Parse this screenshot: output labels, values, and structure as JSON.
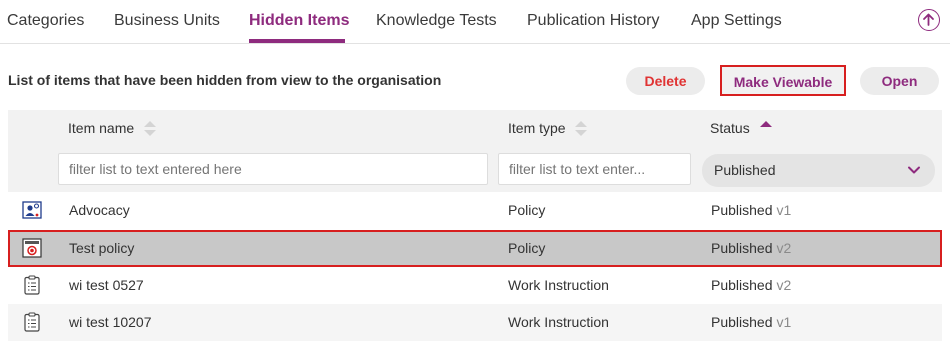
{
  "tabs": [
    {
      "label": "Categories"
    },
    {
      "label": "Business Units"
    },
    {
      "label": "Hidden Items"
    },
    {
      "label": "Knowledge Tests"
    },
    {
      "label": "Publication History"
    },
    {
      "label": "App Settings"
    }
  ],
  "active_tab": "Hidden Items",
  "toolbar": {
    "description": "List of items that have been hidden from view to the organisation",
    "delete_label": "Delete",
    "make_viewable_label": "Make Viewable",
    "open_label": "Open"
  },
  "table": {
    "columns": {
      "item_name": "Item name",
      "item_type": "Item type",
      "status": "Status"
    },
    "filters": {
      "name_placeholder": "filter list to text entered here",
      "type_placeholder": "filter list to text enter...",
      "status_selected": "Published"
    },
    "rows": [
      {
        "icon": "policy-person-icon",
        "name": "Advocacy",
        "type": "Policy",
        "status": "Published",
        "version": "v1"
      },
      {
        "icon": "policy-stamp-icon",
        "name": "Test policy",
        "type": "Policy",
        "status": "Published",
        "version": "v2",
        "selected": true
      },
      {
        "icon": "clipboard-checklist-icon",
        "name": "wi test 0527",
        "type": "Work Instruction",
        "status": "Published",
        "version": "v2"
      },
      {
        "icon": "clipboard-checklist-icon",
        "name": "wi test 10207",
        "type": "Work Instruction",
        "status": "Published",
        "version": "v1"
      }
    ]
  },
  "colors": {
    "accent": "#8e2b7e",
    "delete": "#e03333",
    "highlight_border": "#d71f1f"
  }
}
